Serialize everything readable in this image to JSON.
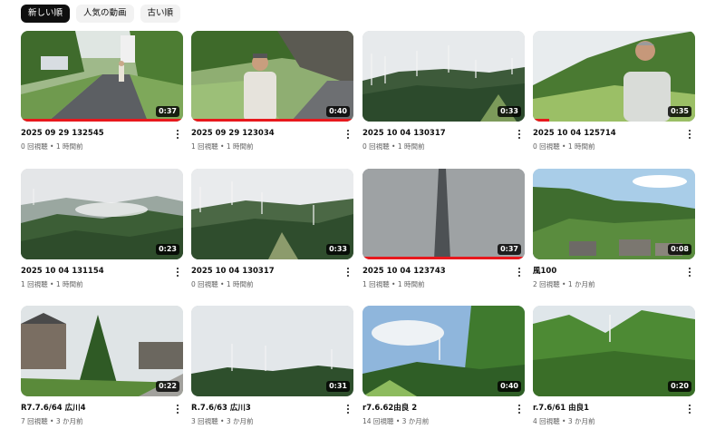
{
  "filters": [
    "新しい順",
    "人気の動画",
    "古い順"
  ],
  "videos": [
    {
      "title": "2025 09 29 132545",
      "views": "0 回視聴",
      "age": "1 時間前",
      "duration": "0:37",
      "progress": 1.0
    },
    {
      "title": "2025 09 29 123034",
      "views": "1 回視聴",
      "age": "1 時間前",
      "duration": "0:40",
      "progress": 1.0
    },
    {
      "title": "2025 10 04 130317",
      "views": "0 回視聴",
      "age": "1 時間前",
      "duration": "0:33",
      "progress": 0
    },
    {
      "title": "2025 10 04 125714",
      "views": "0 回視聴",
      "age": "1 時間前",
      "duration": "0:35",
      "progress": 0.1
    },
    {
      "title": "2025 10 04 131154",
      "views": "1 回視聴",
      "age": "1 時間前",
      "duration": "0:23",
      "progress": 0
    },
    {
      "title": "2025 10 04 130317",
      "views": "0 回視聴",
      "age": "1 時間前",
      "duration": "0:33",
      "progress": 0
    },
    {
      "title": "2025 10 04 123743",
      "views": "1 回視聴",
      "age": "1 時間前",
      "duration": "0:37",
      "progress": 1.0
    },
    {
      "title": "風100",
      "views": "2 回視聴",
      "age": "1 か月前",
      "duration": "0:08",
      "progress": 0
    },
    {
      "title": "R7.7.6/64 広川4",
      "views": "7 回視聴",
      "age": "3 か月前",
      "duration": "0:22",
      "progress": 0
    },
    {
      "title": "R.7.6/63 広川3",
      "views": "3 回視聴",
      "age": "3 か月前",
      "duration": "0:31",
      "progress": 0
    },
    {
      "title": "r7.6.62由良 2",
      "views": "14 回視聴",
      "age": "3 か月前",
      "duration": "0:40",
      "progress": 0
    },
    {
      "title": "r.7.6/61 由良1",
      "views": "4 回視聴",
      "age": "3 か月前",
      "duration": "0:20",
      "progress": 0
    }
  ],
  "separator": " • "
}
